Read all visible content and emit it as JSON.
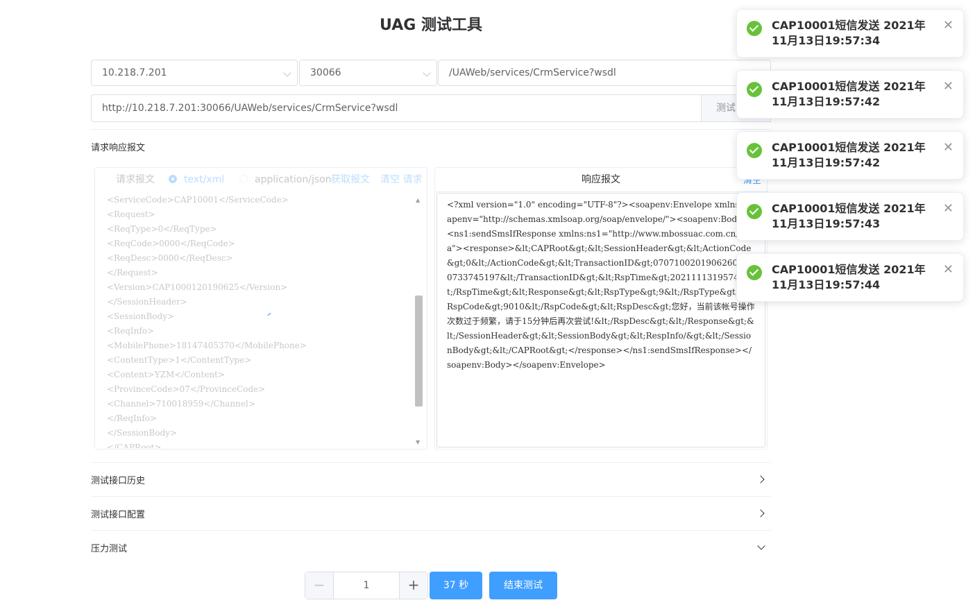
{
  "app": {
    "title": "UAG 测试工具"
  },
  "form": {
    "host": "10.218.7.201",
    "port": "30066",
    "path": "/UAWeb/services/CrmService?wsdl",
    "full_url": "http://10.218.7.201:30066/UAWeb/services/CrmService?wsdl",
    "test_button": "测试"
  },
  "request_section": {
    "title": "请求响应报文",
    "request_label": "请求报文",
    "content_types": [
      "text/xml",
      "application/json"
    ],
    "selected_content_type": "text/xml",
    "fetch_button": "获取报文",
    "clear_request_button": "清空 请求",
    "xml_lines": [
      "<ServiceCode>CAP10001</ServiceCode>",
      "<Request>",
      "<ReqType>0</ReqType>",
      "<ReqCode>0000</ReqCode>",
      "<ReqDesc>0000</ReqDesc>",
      "</Request>",
      "<Version>CAP1000120190625</Version>",
      "</SessionHeader>",
      "<SessionBody>",
      "<ReqInfo>",
      "<MobilePhone>18147405370</MobilePhone>",
      "<ContentType>1</ContentType>",
      "<Content>YZM</Content>",
      "<ProvinceCode>07</ProvinceCode>",
      "<Channel>710018959</Channel>",
      "</ReqInfo>",
      "</SessionBody>",
      "</CAPRoot>"
    ]
  },
  "response_section": {
    "title": "响应报文",
    "clear_button": "清空",
    "text": "<?xml version=\"1.0\" encoding=\"UTF-8\"?><soapenv:Envelope xmlns:soapenv=\"http://schemas.xmlsoap.org/soap/envelope/\"><soapenv:Body><ns1:sendSmsIfResponse xmlns:ns1=\"http://www.mbossuac.com.cn/ua\"><response>&lt;CAPRoot&gt;&lt;SessionHeader&gt;&lt;ActionCode&gt;0&lt;/ActionCode&gt;&lt;TransactionID&gt;07071002019062609170733745197&lt;/TransactionID&gt;&lt;RspTime&gt;20211113195744&lt;/RspTime&gt;&lt;Response&gt;&lt;RspType&gt;9&lt;/RspType&gt;&lt;RspCode&gt;9010&lt;/RspCode&gt;&lt;RspDesc&gt;您好，当前该帐号操作次数过于频繁，请于15分钟后再次尝试!&lt;/RspDesc&gt;&lt;/Response&gt;&lt;/SessionHeader&gt;&lt;SessionBody&gt;&lt;RespInfo/&gt;&lt;/SessionBody&gt;&lt;/CAPRoot&gt;</response></ns1:sendSmsIfResponse></soapenv:Body></soapenv:Envelope>"
  },
  "collapses": {
    "history": "测试接口历史",
    "config": "测试接口配置",
    "pressure": "压力测试"
  },
  "pressure": {
    "count": "1",
    "minus": "−",
    "plus": "+",
    "timer": "37 秒",
    "end_button": "结束测试"
  },
  "notifications": [
    "CAP10001短信发送 2021年11月13日19:57:34",
    "CAP10001短信发送 2021年11月13日19:57:42",
    "CAP10001短信发送 2021年11月13日19:57:42",
    "CAP10001短信发送 2021年11月13日19:57:43",
    "CAP10001短信发送 2021年11月13日19:57:44"
  ],
  "colors": {
    "primary": "#409eff",
    "success": "#67c23a",
    "border": "#dcdfe6"
  },
  "icons": {
    "select_arrow": "chevron-down-icon",
    "collapse_closed": "chevron-right-icon",
    "collapse_open": "chevron-down-icon",
    "notification_status": "success-check-icon",
    "notification_close": "close-icon"
  }
}
